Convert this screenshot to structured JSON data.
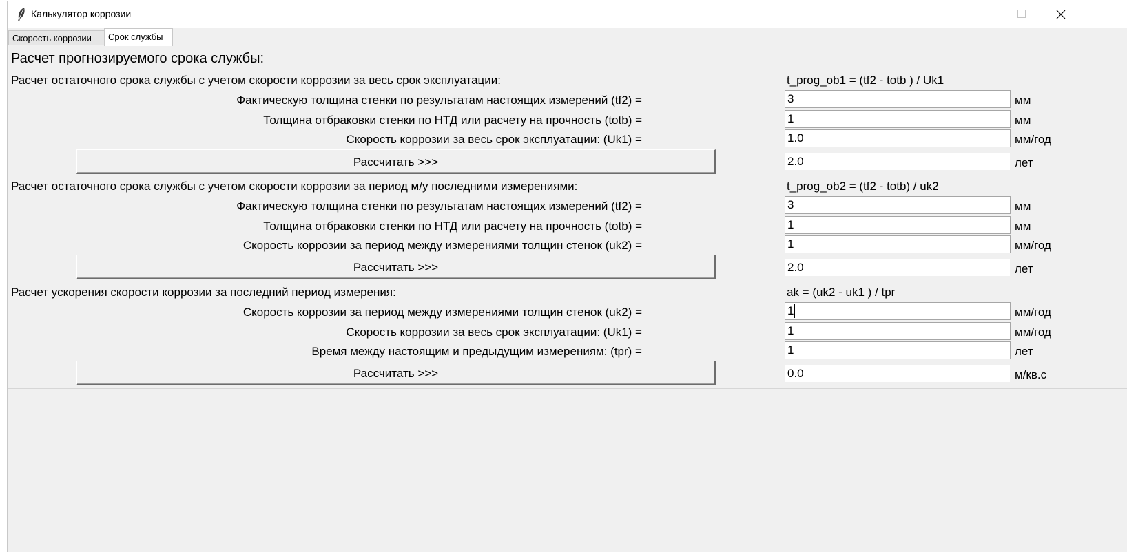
{
  "window": {
    "title": "Калькулятор коррозии"
  },
  "tabs": [
    {
      "label": "Скорость коррозии",
      "active": false
    },
    {
      "label": "Срок службы",
      "active": true
    }
  ],
  "header": "Расчет прогнозируемого срока службы:",
  "section1": {
    "title": "Расчет остаточного срока службы с учетом скорости коррозии за весь срок эксплуатации:",
    "formula": "t_prog_ob1 = (tf2 - totb ) / Uk1",
    "rows": [
      {
        "label": "Фактическую толщина стенки по результатам настоящих измерений (tf2) =",
        "value": "3",
        "unit": "мм"
      },
      {
        "label": "Толщина отбраковки стенки по НТД или расчету на прочность (totb) =",
        "value": "1",
        "unit": "мм"
      },
      {
        "label": "Скорость коррозии за весь срок эксплуатации: (Uk1) =",
        "value": "1.0",
        "unit": "мм/год"
      }
    ],
    "button": "Рассчитать >>>",
    "result": {
      "value": "2.0",
      "unit": "лет"
    }
  },
  "section2": {
    "title": "Расчет остаточного срока службы с учетом скорости коррозии за период м/у последними измерениями:",
    "formula": "t_prog_ob2 = (tf2 - totb) / uk2",
    "rows": [
      {
        "label": "Фактическую толщина стенки по результатам настоящих измерений (tf2) =",
        "value": "3",
        "unit": "мм"
      },
      {
        "label": "Толщина отбраковки стенки по НТД или расчету на прочность (totb) =",
        "value": "1",
        "unit": "мм"
      },
      {
        "label": "Скорость коррозии за период между измерениями толщин стенок (uk2) =",
        "value": "1",
        "unit": "мм/год"
      }
    ],
    "button": "Рассчитать >>>",
    "result": {
      "value": "2.0",
      "unit": "лет"
    }
  },
  "section3": {
    "title": "Расчет ускорения скорости коррозии за последний период измерения:",
    "formula": "ak = (uk2 - uk1 ) / tpr",
    "rows": [
      {
        "label": "Скорость коррозии за период между измерениями толщин стенок (uk2) =",
        "value": "1",
        "unit": "мм/год"
      },
      {
        "label": "Скорость коррозии за весь срок эксплуатации: (Uk1) =",
        "value": "1",
        "unit": "мм/год"
      },
      {
        "label": "Время между настоящим и предыдущим измерениям: (tpr) =",
        "value": "1",
        "unit": "лет"
      }
    ],
    "button": "Рассчитать >>>",
    "result": {
      "value": "0.0",
      "unit": "м/кв.с"
    }
  }
}
